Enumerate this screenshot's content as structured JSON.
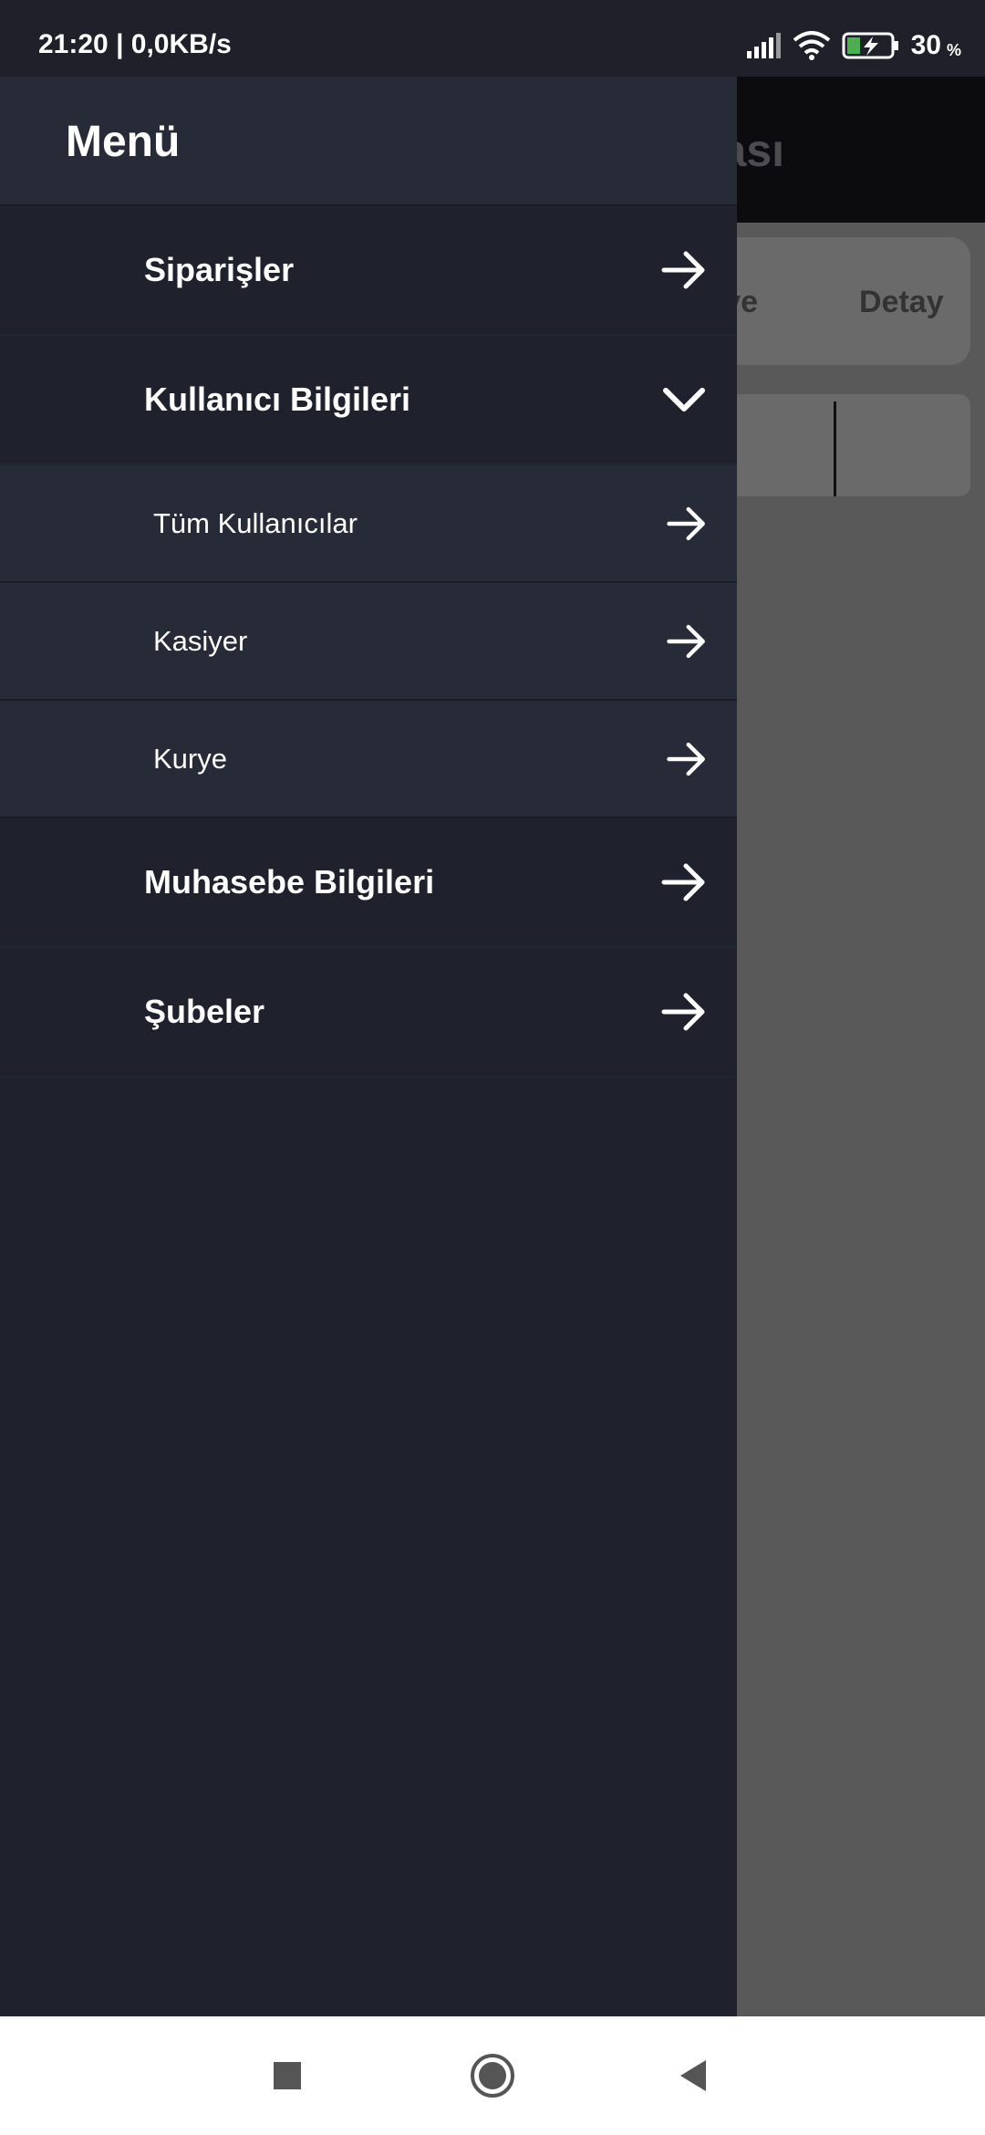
{
  "status_bar": {
    "time": "21:20 | 0,0KB/s",
    "battery_level": "30",
    "battery_unit": "%",
    "icons": [
      "signal-icon",
      "wifi-icon",
      "battery-charging-icon"
    ]
  },
  "background": {
    "header_title": "nası",
    "tab_kurye": "rye",
    "tab_detay": "Detay"
  },
  "drawer": {
    "title": "Menü",
    "items": [
      {
        "label": "Siparişler",
        "icon": "arrow-right-icon"
      },
      {
        "label": "Kullanıcı Bilgileri",
        "icon": "chevron-down-icon",
        "expanded": true,
        "sub_items": [
          {
            "label": "Tüm Kullanıcılar",
            "icon": "arrow-right-icon"
          },
          {
            "label": "Kasiyer",
            "icon": "arrow-right-icon"
          },
          {
            "label": "Kurye",
            "icon": "arrow-right-icon"
          }
        ]
      },
      {
        "label": "Muhasebe Bilgileri",
        "icon": "arrow-right-icon"
      },
      {
        "label": "Şubeler",
        "icon": "arrow-right-icon"
      }
    ]
  },
  "nav_bar": {
    "buttons": [
      "recents-square-icon",
      "home-circle-icon",
      "back-triangle-icon"
    ]
  },
  "colors": {
    "drawer_bg": "#1f212d",
    "drawer_sub_bg": "#272a37",
    "scrim": "#595959",
    "text": "#ffffff"
  }
}
